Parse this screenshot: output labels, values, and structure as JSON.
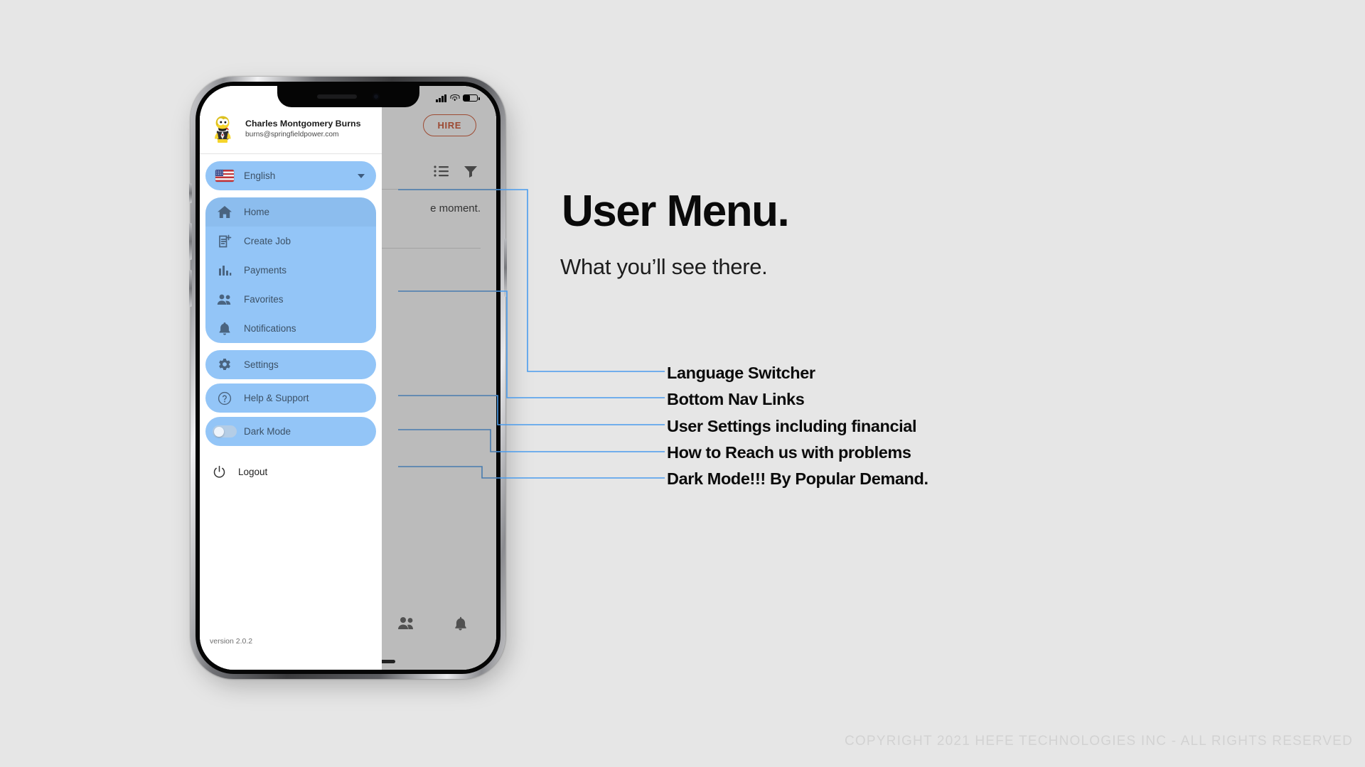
{
  "headline": "User Menu.",
  "subhead": "What you’ll see there.",
  "copyright": "COPYRIGHT 2021 HEFE TECHNOLOGIES INC - ALL RIGHTS RESERVED",
  "phone": {
    "status_bar": {
      "signal_bars": 4,
      "wifi": "wifi-icon",
      "battery": "battery-icon"
    },
    "app": {
      "hire_button": "HIRE",
      "empty_text": "e moment.",
      "toolbar_icons": [
        "list-view-icon",
        "filter-icon"
      ],
      "bottom_nav_icons": [
        "people-icon",
        "bell-icon"
      ]
    },
    "drawer": {
      "profile": {
        "name": "Charles Montgomery Burns",
        "email": "burns@springfieldpower.com",
        "avatar": "user-avatar"
      },
      "language": {
        "label": "English",
        "flag": "us-flag-icon",
        "caret": "chevron-down-icon"
      },
      "nav_items": [
        {
          "label": "Home",
          "icon": "home-icon",
          "active": true
        },
        {
          "label": "Create Job",
          "icon": "create-job-icon",
          "active": false
        },
        {
          "label": "Payments",
          "icon": "bar-chart-icon",
          "active": false
        },
        {
          "label": "Favorites",
          "icon": "people-icon",
          "active": false
        },
        {
          "label": "Notifications",
          "icon": "bell-icon",
          "active": false
        }
      ],
      "settings_item": {
        "label": "Settings",
        "icon": "gear-icon"
      },
      "help_item": {
        "label": "Help & Support",
        "icon": "question-circle-icon"
      },
      "dark_mode": {
        "label": "Dark Mode",
        "icon": "toggle-off-icon",
        "enabled": false
      },
      "logout": {
        "label": "Logout",
        "icon": "power-icon"
      },
      "version": "version 2.0.2"
    }
  },
  "annotations": [
    {
      "label": "Language Switcher"
    },
    {
      "label": "Bottom Nav Links"
    },
    {
      "label": "User Settings including financial"
    },
    {
      "label": "How to Reach us with problems"
    },
    {
      "label": "Dark Mode!!! By Popular Demand."
    }
  ],
  "colors": {
    "background": "#e6e6e6",
    "pill": "#93c5f7",
    "pill_active": "#8cbdee",
    "accent_line": "#4a9ced",
    "hire_border": "#d1502a"
  }
}
